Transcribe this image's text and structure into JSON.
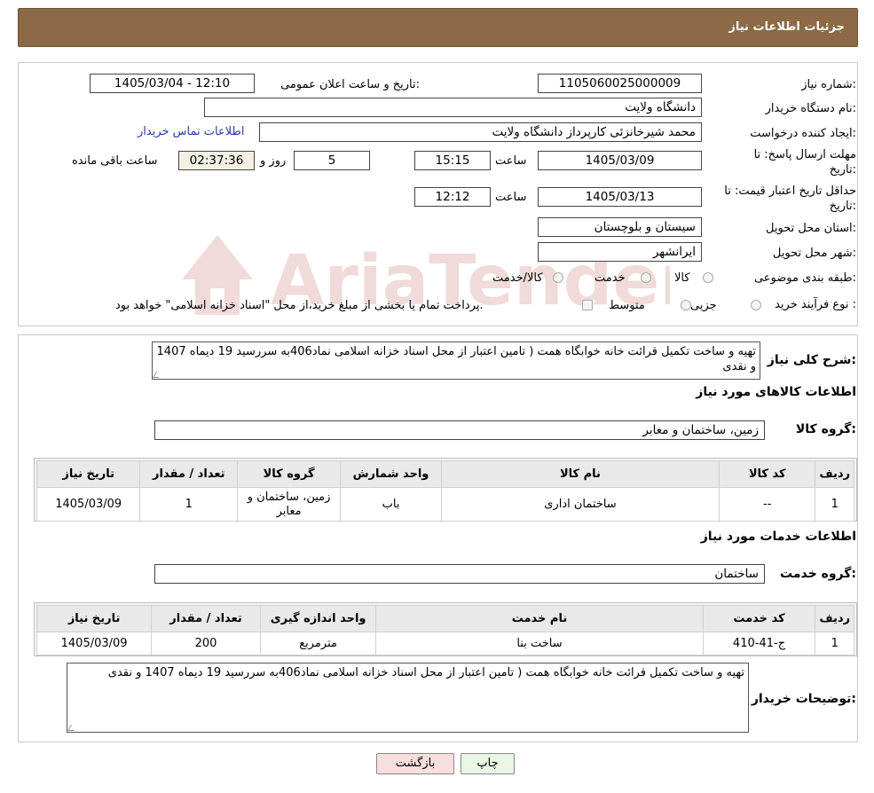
{
  "header": {
    "title": "جزئیات اطلاعات نیاز"
  },
  "form": {
    "need_number_label": "شماره نیاز:",
    "need_number": "1105060025000009",
    "announce_label": "تاریخ و ساعت اعلان عمومی:",
    "announce_value": "1405/03/04 - 12:10",
    "buyer_org_label": "نام دستگاه خریدار:",
    "buyer_org": "دانشگاه ولایت",
    "creator_label": "ایجاد کننده درخواست:",
    "creator": "محمد شیرخانزئی کارپرداز دانشگاه ولایت",
    "contact_link": "اطلاعات تماس خریدار",
    "deadline_label_1": "مهلت ارسال پاسخ: تا",
    "deadline_label_2": "تاریخ:",
    "deadline_date": "1405/03/09",
    "hour_label": "ساعت",
    "deadline_time": "15:15",
    "days_value": "5",
    "days_label": "روز و",
    "remaining_time": "02:37:36",
    "remaining_label": "ساعت باقی مانده",
    "validity_label_1": "حداقل تاریخ اعتبار قیمت: تا",
    "validity_label_2": "تاریخ:",
    "validity_date": "1405/03/13",
    "validity_time": "12:12",
    "province_label": "استان محل تحویل:",
    "province": "سیستان و بلوچستان",
    "city_label": "شهر محل تحویل:",
    "city": "ایرانشهر",
    "category_label": "طبقه بندی موضوعی:",
    "category_options": [
      "کالا",
      "خدمت",
      "کالا/خدمت"
    ],
    "process_label": "نوع فرآیند خرید :",
    "process_options": [
      "جزیی",
      "متوسط"
    ],
    "process_note": "پرداخت تمام یا بخشی از مبلغ خرید،از محل \"اسناد خزانه اسلامی\" خواهد بود."
  },
  "summary": {
    "label": "شرح کلی نیاز:",
    "text": "تهیه و ساخت  تکمیل قرائت خانه خوابگاه همت ( تامین اعتبار از محل اسناد خزانه اسلامی نماد406به سررسید 19 دیماه 1407 و نقدی"
  },
  "goods": {
    "title": "اطلاعات کالاهای مورد نیاز",
    "group_label": "گروه کالا:",
    "group_value": "زمین، ساختمان و معابر",
    "headers": [
      "ردیف",
      "کد کالا",
      "نام کالا",
      "واحد شمارش",
      "گروه کالا",
      "تعداد / مقدار",
      "تاریخ نیاز"
    ],
    "rows": [
      [
        "1",
        "--",
        "ساختمان اداری",
        "باب",
        "زمین، ساختمان و معابر",
        "1",
        "1405/03/09"
      ]
    ]
  },
  "services": {
    "title": "اطلاعات خدمات مورد نیاز",
    "group_label": "گروه خدمت:",
    "group_value": "ساختمان",
    "headers": [
      "ردیف",
      "کد خدمت",
      "نام خدمت",
      "واحد اندازه گیری",
      "تعداد / مقدار",
      "تاریخ نیاز"
    ],
    "rows": [
      [
        "1",
        "ج-41-410",
        "ساخت بنا",
        "مترمربع",
        "200",
        "1405/03/09"
      ]
    ]
  },
  "buyer_notes": {
    "label": "توضیحات خریدار:",
    "text": "تهیه و ساخت  تکمیل قرائت خانه خوابگاه همت ( تامین اعتبار از محل اسناد خزانه اسلامی نماد406به سررسید 19 دیماه 1407 و نقدی"
  },
  "buttons": {
    "print": "چاپ",
    "back": "بازگشت"
  },
  "watermark": {
    "text": "AriaTender.neT"
  },
  "colors": {
    "header_bg": "#8b6a45",
    "back_button_bg": "#f9dede",
    "print_button_bg": "#e8f7e4",
    "link": "#2a3aa8"
  }
}
